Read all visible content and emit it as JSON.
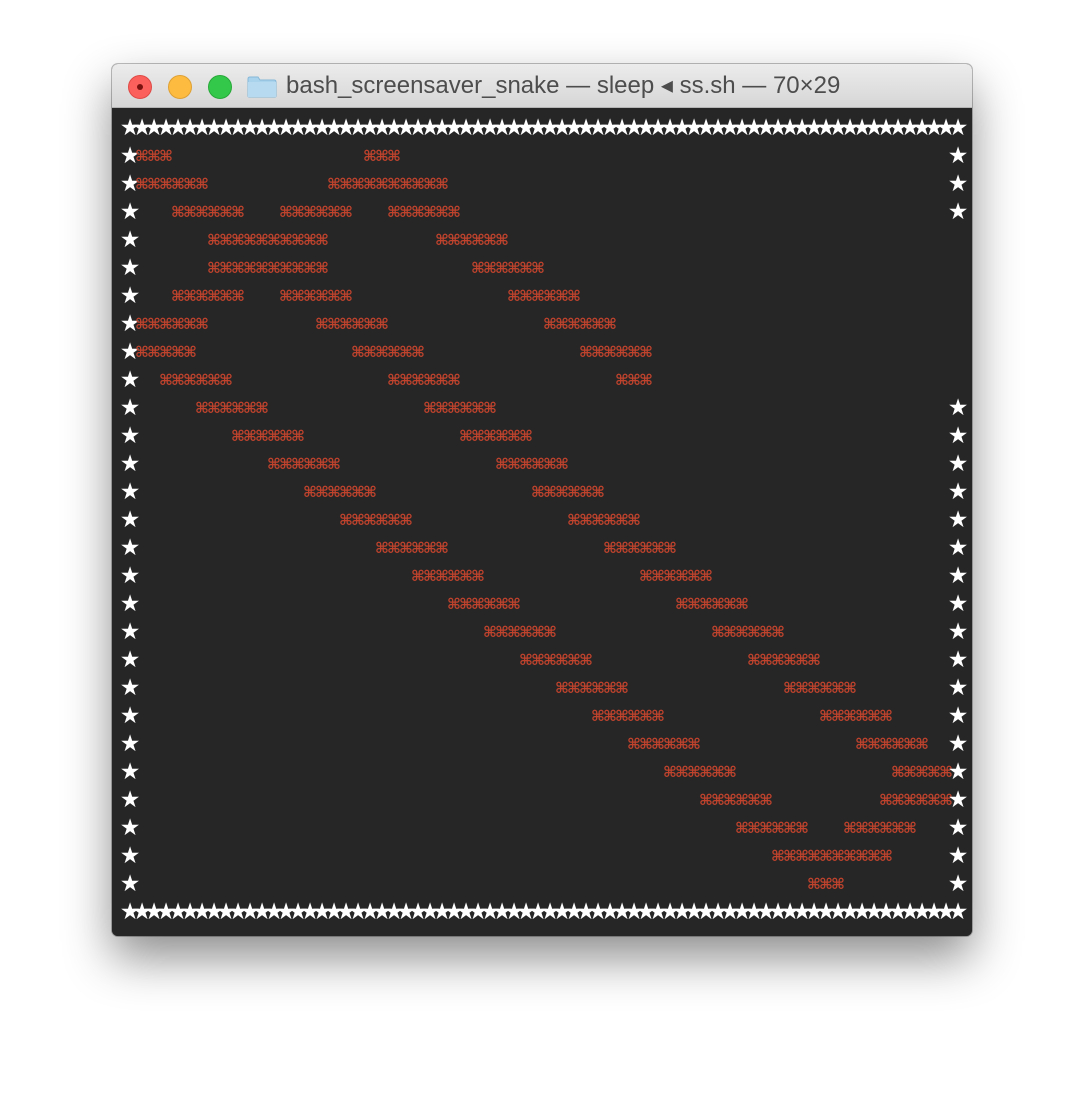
{
  "window": {
    "title": "bash_screensaver_snake — sleep ◂ ss.sh — 70×29",
    "icons": {
      "close": "close-button",
      "minimize": "minimize-button",
      "zoom": "zoom-button",
      "folder": "folder-icon"
    },
    "colors": {
      "titlebar": "#e3e3e3",
      "terminal_background": "#262626",
      "border_star": "#ffffff",
      "snake": "#c0432d"
    }
  },
  "terminal": {
    "columns": 70,
    "rows": 29,
    "border_glyph": "★",
    "snake_glyph": "⌘",
    "rows_content": [
      "★★★★★★★★★★★★★★★★★★★★★★★★★★★★★★★★★★★★★★★★★★★★★★★★★★★★★★★★★★★★★★★★★★★★★★",
      "★⌘⌘⌘                ⌘⌘⌘                                              ★",
      "★⌘⌘⌘⌘⌘⌘          ⌘⌘⌘⌘⌘⌘⌘⌘⌘⌘                                          ★",
      "★   ⌘⌘⌘⌘⌘⌘   ⌘⌘⌘⌘⌘⌘   ⌘⌘⌘⌘⌘⌘                                         ★",
      "★      ⌘⌘⌘⌘⌘⌘⌘⌘⌘⌘         ⌘⌘⌘⌘⌘⌘                                      ★",
      "★      ⌘⌘⌘⌘⌘⌘⌘⌘⌘⌘            ⌘⌘⌘⌘⌘⌘                                   ★",
      "★   ⌘⌘⌘⌘⌘⌘   ⌘⌘⌘⌘⌘⌘             ⌘⌘⌘⌘⌘⌘                                ★",
      "★⌘⌘⌘⌘⌘⌘         ⌘⌘⌘⌘⌘⌘             ⌘⌘⌘⌘⌘⌘                             ★",
      "★⌘⌘⌘⌘⌘             ⌘⌘⌘⌘⌘⌘             ⌘⌘⌘⌘⌘⌘                          ★",
      "★  ⌘⌘⌘⌘⌘⌘             ⌘⌘⌘⌘⌘⌘             ⌘⌘⌘                          ★",
      "★     ⌘⌘⌘⌘⌘⌘             ⌘⌘⌘⌘⌘⌘                                      ★",
      "★        ⌘⌘⌘⌘⌘⌘             ⌘⌘⌘⌘⌘⌘                                   ★",
      "★           ⌘⌘⌘⌘⌘⌘             ⌘⌘⌘⌘⌘⌘                                ★",
      "★              ⌘⌘⌘⌘⌘⌘             ⌘⌘⌘⌘⌘⌘                             ★",
      "★                 ⌘⌘⌘⌘⌘⌘             ⌘⌘⌘⌘⌘⌘                          ★",
      "★                    ⌘⌘⌘⌘⌘⌘             ⌘⌘⌘⌘⌘⌘                       ★",
      "★                       ⌘⌘⌘⌘⌘⌘             ⌘⌘⌘⌘⌘⌘                    ★",
      "★                          ⌘⌘⌘⌘⌘⌘             ⌘⌘⌘⌘⌘⌘                 ★",
      "★                             ⌘⌘⌘⌘⌘⌘             ⌘⌘⌘⌘⌘⌘              ★",
      "★                                ⌘⌘⌘⌘⌘⌘             ⌘⌘⌘⌘⌘⌘           ★",
      "★                                   ⌘⌘⌘⌘⌘⌘             ⌘⌘⌘⌘⌘⌘        ★",
      "★                                      ⌘⌘⌘⌘⌘⌘             ⌘⌘⌘⌘⌘⌘     ★",
      "★                                         ⌘⌘⌘⌘⌘⌘             ⌘⌘⌘⌘⌘⌘  ★",
      "★                                            ⌘⌘⌘⌘⌘⌘             ⌘⌘⌘⌘⌘★",
      "★                                               ⌘⌘⌘⌘⌘⌘         ⌘⌘⌘⌘⌘⌘★",
      "★                                                  ⌘⌘⌘⌘⌘⌘   ⌘⌘⌘⌘⌘⌘   ★",
      "★                                                     ⌘⌘⌘⌘⌘⌘⌘⌘⌘⌘     ★",
      "★                                                        ⌘⌘⌘         ★",
      "★★★★★★★★★★★★★★★★★★★★★★★★★★★★★★★★★★★★★★★★★★★★★★★★★★★★★★★★★★★★★★★★★★★★★★"
    ]
  }
}
